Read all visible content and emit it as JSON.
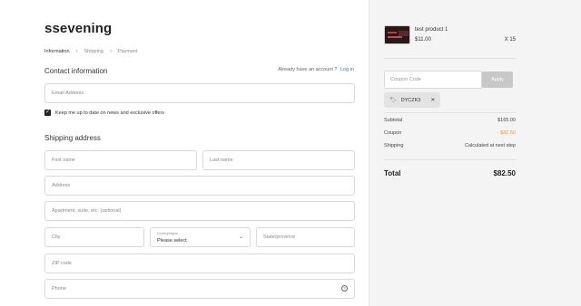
{
  "store": {
    "title": "ssevening"
  },
  "breadcrumb": {
    "step1": "Information",
    "sep1": "›",
    "step2": "Shipping",
    "sep2": "›",
    "step3": "Payment"
  },
  "contact": {
    "heading": "Contact information",
    "account_prompt": "Already have an account ?",
    "login_link": "Log in",
    "email_placeholder": "Email Address",
    "newsletter_checked": true,
    "newsletter_label": "Keep me up to date on news and exclusive offers"
  },
  "shipping": {
    "heading": "Shipping address",
    "first_name_placeholder": "First name",
    "last_name_placeholder": "Last name",
    "address_placeholder": "Address",
    "apartment_placeholder": "Apartment, suite, etc. (optional)",
    "city_placeholder": "City",
    "country_label": "Country/region",
    "country_value": "Please select",
    "state_placeholder": "State/province",
    "zip_placeholder": "ZIP code",
    "phone_placeholder": "Phone"
  },
  "cart": {
    "product_name": "test product 1",
    "product_price": "$11.00",
    "product_qty": "X 15",
    "coupon_placeholder": "Coupon Code",
    "apply_label": "Apply",
    "applied_code": "DYCZK3",
    "subtotal_label": "Subtotal",
    "subtotal_value": "$165.00",
    "coupon_label": "Coupon",
    "coupon_value": "- $82.50",
    "shipping_label": "Shipping",
    "shipping_value": "Calculated at next step",
    "total_label": "Total",
    "total_value": "$82.50"
  },
  "colors": {
    "link": "#2a7fd1",
    "discount": "#e39b2c",
    "sidebar_bg": "#f4f4f4"
  },
  "icons": {
    "chevron": "chevron-down-icon",
    "help": "phone-help-icon",
    "tag": "tag-icon",
    "close": "close-icon"
  }
}
